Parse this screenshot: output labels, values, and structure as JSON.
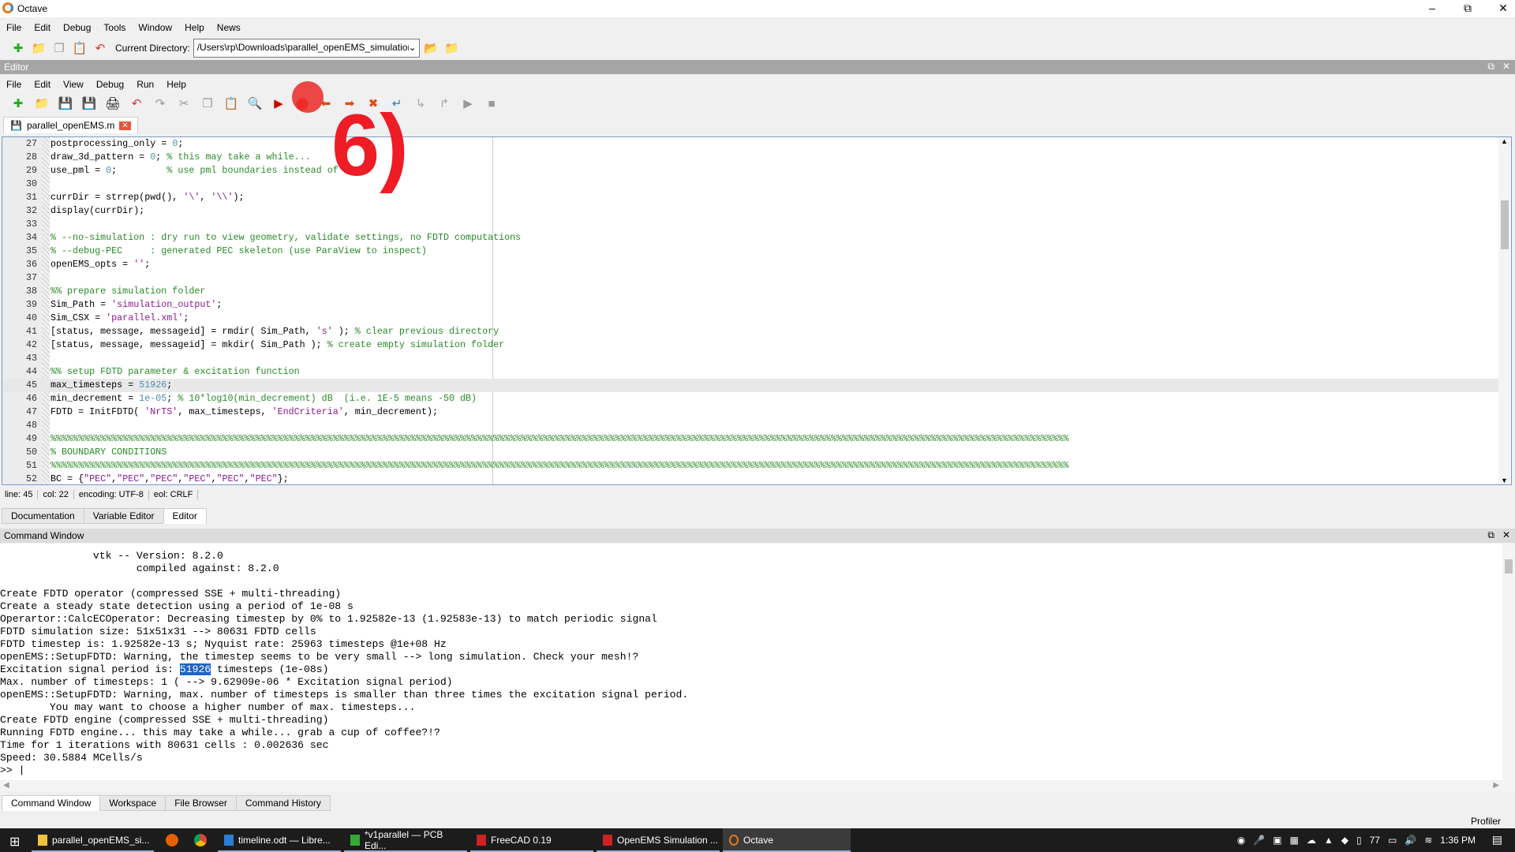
{
  "app": {
    "title": "Octave",
    "menu": [
      "File",
      "Edit",
      "Debug",
      "Tools",
      "Window",
      "Help",
      "News"
    ],
    "current_directory_label": "Current Directory:",
    "current_directory": "/Users\\rp\\Downloads\\parallel_openEMS_simulation"
  },
  "editor": {
    "header": "Editor",
    "menu": [
      "File",
      "Edit",
      "View",
      "Debug",
      "Run",
      "Help"
    ],
    "tab": "parallel_openEMS.m",
    "lines": [
      {
        "n": "27",
        "h": "postprocessing_only = <span class=num>0</span>;"
      },
      {
        "n": "28",
        "h": "draw_3d_pattern = <span class=num>0</span>; <span class=cm>% this may take a while...</span>"
      },
      {
        "n": "29",
        "h": "use_pml = <span class=num>0</span>;         <span class=cm>% use pml boundaries instead of mur</span>"
      },
      {
        "n": "30",
        "h": ""
      },
      {
        "n": "31",
        "h": "currDir = strrep(pwd(), <span class=str>'\\'</span>, <span class=str>'\\\\'</span>);"
      },
      {
        "n": "32",
        "h": "display(currDir);"
      },
      {
        "n": "33",
        "h": ""
      },
      {
        "n": "34",
        "h": "<span class=cm>% --no-simulation : dry run to view geometry, validate settings, no FDTD computations</span>"
      },
      {
        "n": "35",
        "h": "<span class=cm>% --debug-PEC     : generated PEC skeleton (use ParaView to inspect)</span>"
      },
      {
        "n": "36",
        "h": "openEMS_opts = <span class=str>''</span>;"
      },
      {
        "n": "37",
        "h": ""
      },
      {
        "n": "38",
        "h": "<span class=cm>%% prepare simulation folder</span>"
      },
      {
        "n": "39",
        "h": "Sim_Path = <span class=str>'simulation_output'</span>;"
      },
      {
        "n": "40",
        "h": "Sim_CSX = <span class=str>'parallel.xml'</span>;"
      },
      {
        "n": "41",
        "h": "[status, message, messageid] = rmdir( Sim_Path, <span class=str>'s'</span> ); <span class=cm>% clear previous directory</span>"
      },
      {
        "n": "42",
        "h": "[status, message, messageid] = mkdir( Sim_Path ); <span class=cm>% create empty simulation folder</span>"
      },
      {
        "n": "43",
        "h": ""
      },
      {
        "n": "44",
        "h": "<span class=cm>%% setup FDTD parameter &amp; excitation function</span>"
      },
      {
        "n": "45",
        "h": "max_timesteps = <span class=num>51926</span>;",
        "cur": true
      },
      {
        "n": "46",
        "h": "min_decrement = <span class=num>1e-05</span>; <span class=cm>% 10*log10(min_decrement) dB  (i.e. 1E-5 means -50 dB)</span>"
      },
      {
        "n": "47",
        "h": "FDTD = InitFDTD( <span class=str>'NrTS'</span>, max_timesteps, <span class=str>'EndCriteria'</span>, min_decrement);"
      },
      {
        "n": "48",
        "h": ""
      },
      {
        "n": "49",
        "h": "<span class=cm>%%%%%%%%%%%%%%%%%%%%%%%%%%%%%%%%%%%%%%%%%%%%%%%%%%%%%%%%%%%%%%%%%%%%%%%%%%%%%%%%%%%%%%%%%%%%%%%%%%%%%%%%%%%%%%%%%%%%%%%%%%%%%%%%%%%%%%%%%%%%%%%%%%%%%%%%%%%%%%%%%%%%%%%%%%%%%%%%%%%%%%%%</span>"
      },
      {
        "n": "50",
        "h": "<span class=cm>% BOUNDARY CONDITIONS</span>"
      },
      {
        "n": "51",
        "h": "<span class=cm>%%%%%%%%%%%%%%%%%%%%%%%%%%%%%%%%%%%%%%%%%%%%%%%%%%%%%%%%%%%%%%%%%%%%%%%%%%%%%%%%%%%%%%%%%%%%%%%%%%%%%%%%%%%%%%%%%%%%%%%%%%%%%%%%%%%%%%%%%%%%%%%%%%%%%%%%%%%%%%%%%%%%%%%%%%%%%%%%%%%%%%%%</span>"
      },
      {
        "n": "52",
        "h": "BC = {<span class=str>\"PEC\"</span>,<span class=str>\"PEC\"</span>,<span class=str>\"PEC\"</span>,<span class=str>\"PEC\"</span>,<span class=str>\"PEC\"</span>,<span class=str>\"PEC\"</span>};"
      }
    ],
    "status": {
      "line": "line: 45",
      "col": "col: 22",
      "encoding": "encoding: UTF-8",
      "eol": "eol: CRLF"
    }
  },
  "dock_tabs": [
    "Documentation",
    "Variable Editor",
    "Editor"
  ],
  "command_window": {
    "header": "Command Window",
    "lines": [
      "               vtk -- Version: 8.2.0",
      "                      compiled against: 8.2.0",
      "",
      "Create FDTD operator (compressed SSE + multi-threading)",
      "Create a steady state detection using a period of 1e-08 s",
      "Operartor::CalcECOperator: Decreasing timestep by 0% to 1.92582e-13 (1.92583e-13) to match periodic signal",
      "FDTD simulation size: 51x51x31 --> 80631 FDTD cells",
      "FDTD timestep is: 1.92582e-13 s; Nyquist rate: 25963 timesteps @1e+08 Hz",
      "openEMS::SetupFDTD: Warning, the timestep seems to be very small --> long simulation. Check your mesh!?",
      "Excitation signal period is: <span class=sel>51926</span> timesteps (1e-08s)",
      "Max. number of timesteps: 1 ( --> 9.62909e-06 * Excitation signal period)",
      "openEMS::SetupFDTD: Warning, max. number of timesteps is smaller than three times the excitation signal period.",
      "        You may want to choose a higher number of max. timesteps...",
      "Create FDTD engine (compressed SSE + multi-threading)",
      "Running FDTD engine... this may take a while... grab a cup of coffee?!?",
      "Time for 1 iterations with 80631 cells : 0.002636 sec",
      "Speed: 30.5884 MCells/s",
      ">> |"
    ]
  },
  "bottom_tabs": [
    "Command Window",
    "Workspace",
    "File Browser",
    "Command History"
  ],
  "profiler": "Profiler",
  "annotation": "6)",
  "taskbar": {
    "items": [
      "parallel_openEMS_si...",
      "timeline.odt — Libre...",
      "*v1parallel — PCB Edi...",
      "FreeCAD 0.19",
      "OpenEMS Simulation ...",
      "Octave"
    ],
    "tray_number": "77",
    "clock": "1:36 PM"
  }
}
